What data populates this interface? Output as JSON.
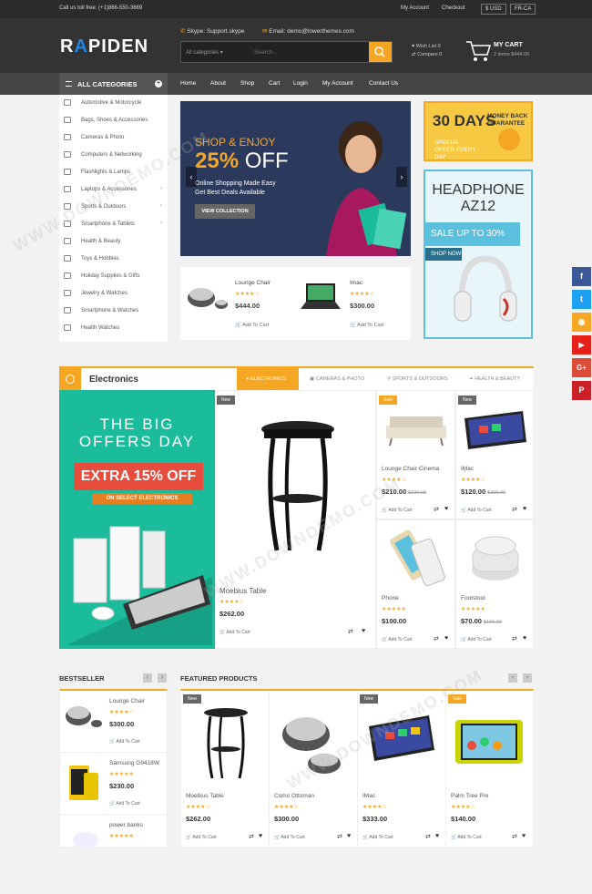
{
  "topbar": {
    "phone": "Call us toll free: (+1)866-550-3669",
    "account": "My Account",
    "checkout": "Checkout",
    "currency": "$ USD",
    "language": "FR-CA"
  },
  "header": {
    "logo": "RAPIDEN",
    "logo_a": "A",
    "skype": "Skype: Support.skype",
    "email": "Email: demo@lowerthemes.com",
    "search_cat": "All categories",
    "search_placeholder": "Search...",
    "wishlist": "Wish List 0",
    "compare": "Compare 0",
    "cart_title": "MY CART",
    "cart_sub": "2 items $444.00"
  },
  "nav": {
    "all_categories": "ALL CATEGORIES",
    "items": [
      "Home",
      "About",
      "Shop",
      "Cart",
      "Login",
      "My Account",
      "Contact Us"
    ]
  },
  "sidebar": [
    "Automotive & Motorcycle",
    "Bags, Shoes & Accessories",
    "Cameras & Photo",
    "Computers & Networking",
    "Flashlights & Lamps",
    "Laptops & Accessories",
    "Sports & Outdoors",
    "Smartphone & Tablets",
    "Health & Beauty",
    "Toys & Hobbies",
    "Holiday Supplies & Gifts",
    "Jewelry & Watches",
    "Smartphone & Watches",
    "Health Watches"
  ],
  "slider": {
    "line1": "SHOP & ENJOY",
    "pct": "25%",
    "off": "OFF",
    "line3a": "Online Shopping Made Easy",
    "line3b": "Get Best Deals Available",
    "btn": "VIEW COLLECTION"
  },
  "mini": [
    {
      "name": "Lounge Chair",
      "stars": "★★★★☆",
      "price": "$444.00",
      "cart": "Add To Cart"
    },
    {
      "name": "Imac",
      "stars": "★★★★☆",
      "price": "$300.00",
      "cart": "Add To Cart"
    }
  ],
  "ad1": {
    "days": "30 DAYS",
    "money": "MONEY BACK GUARANTEE",
    "special": "SPECIAL OFFER EVERY DAY"
  },
  "ad2": {
    "title1": "HEADPHONE",
    "title2": "AZ12",
    "sale": "SALE UP TO 30% OFF",
    "shop": "SHOP NOW"
  },
  "electronics": {
    "title": "Electronics",
    "tabs": [
      "ELECTRONICS",
      "CAMERAS & PHOTO",
      "SPORTS & OUTDOORS",
      "HEALTH & BEAUTY"
    ]
  },
  "promo": {
    "l1": "THE BIG",
    "l2": "OFFERS DAY",
    "extra": "EXTRA 15% OFF",
    "select": "ON SELECT ELECTRONICS"
  },
  "elec_main": {
    "badge": "New",
    "name": "Moebius Table",
    "stars": "★★★★☆",
    "price": "$262.00",
    "cart": "Add To Cart"
  },
  "elec_grid": [
    {
      "badge": "Sale",
      "name": "Lounge Chair Cinema",
      "stars": "★★★★☆",
      "price": "$210.00",
      "old": "$230.00",
      "cart": "Add To Cart"
    },
    {
      "badge": "New",
      "name": "IMac",
      "stars": "★★★★☆",
      "price": "$120.00",
      "old": "$300.00",
      "cart": "Add To Cart"
    },
    {
      "badge": "",
      "name": "Phone",
      "stars": "★★★★★",
      "price": "$100.00",
      "old": "",
      "cart": "Add To Cart"
    },
    {
      "badge": "",
      "name": "Footstool",
      "stars": "★★★★★",
      "price": "$70.00",
      "old": "$100.00",
      "cart": "Add To Cart"
    }
  ],
  "bestseller": {
    "title": "BESTSELLER",
    "items": [
      {
        "name": "Lounge Chair",
        "stars": "★★★★☆",
        "price": "$300.00",
        "cart": "Add To Cart"
      },
      {
        "name": "Samsung G9418W",
        "stars": "★★★★★",
        "price": "$230.00",
        "cart": "Add To Cart"
      },
      {
        "name": "power banks",
        "stars": "★★★★★",
        "price": "$120.00",
        "cart": "Add To Cart"
      }
    ]
  },
  "featured": {
    "title": "FEATURED PRODUCTS",
    "items": [
      {
        "badge": "New",
        "name": "Moebius Table",
        "stars": "★★★★☆",
        "price": "$262.00",
        "cart": "Add To Cart"
      },
      {
        "badge": "",
        "name": "Como Ottoman",
        "stars": "★★★★☆",
        "price": "$300.00",
        "cart": "Add To Cart"
      },
      {
        "badge": "New",
        "name": "IMac",
        "stars": "★★★★☆",
        "price": "$333.00",
        "cart": "Add To Cart"
      },
      {
        "badge": "Sale",
        "name": "Palm Tree Pre",
        "stars": "★★★★☆",
        "price": "$140.00",
        "cart": "Add To Cart"
      }
    ]
  },
  "social": [
    {
      "icon": "facebook-icon",
      "glyph": "f",
      "color": "#3b5998"
    },
    {
      "icon": "twitter-icon",
      "glyph": "t",
      "color": "#1da1f2"
    },
    {
      "icon": "rss-icon",
      "glyph": "◉",
      "color": "#f5a623"
    },
    {
      "icon": "youtube-icon",
      "glyph": "▶",
      "color": "#e62117"
    },
    {
      "icon": "google-plus-icon",
      "glyph": "G+",
      "color": "#dd4b39"
    },
    {
      "icon": "pinterest-icon",
      "glyph": "P",
      "color": "#cb2027"
    }
  ],
  "watermark": "WWW.DOWNDEMO.COM"
}
